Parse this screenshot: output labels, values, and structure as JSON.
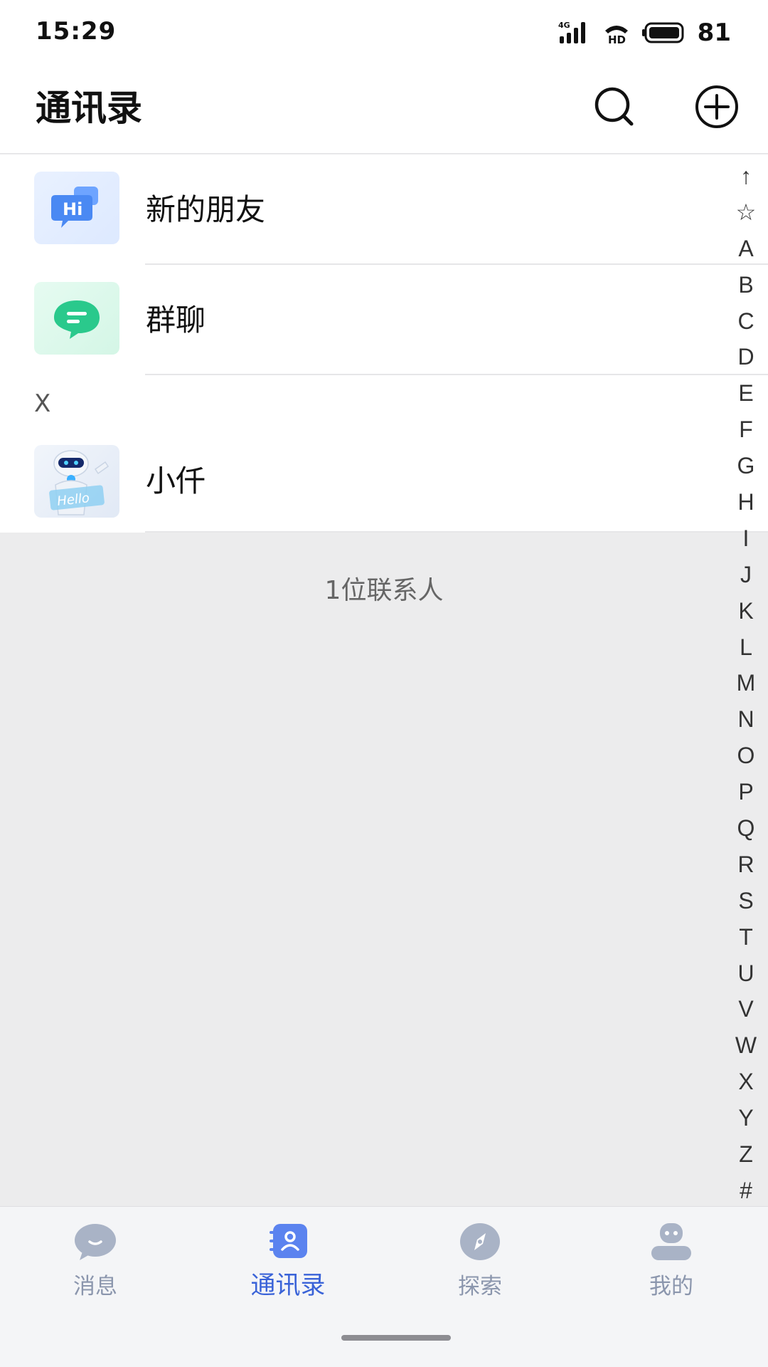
{
  "status_bar": {
    "time": "15:29",
    "network": "4G",
    "hd_label": "HD",
    "battery": "81"
  },
  "header": {
    "title": "通讯录",
    "icons": [
      "search-icon",
      "add-circle-icon"
    ]
  },
  "list": {
    "new_friends": "新的朋友",
    "group_chat": "群聊",
    "section_letter": "X",
    "contacts": [
      {
        "name": "小仟",
        "avatar_text": "Hello"
      }
    ],
    "new_friends_avatar_text": "Hi"
  },
  "contact_count": "1位联系人",
  "alpha_index": [
    "↑",
    "☆",
    "A",
    "B",
    "C",
    "D",
    "E",
    "F",
    "G",
    "H",
    "I",
    "J",
    "K",
    "L",
    "M",
    "N",
    "O",
    "P",
    "Q",
    "R",
    "S",
    "T",
    "U",
    "V",
    "W",
    "X",
    "Y",
    "Z",
    "#"
  ],
  "bottom_nav": {
    "items": [
      {
        "label": "消息",
        "icon": "message-bubble-icon",
        "active": false
      },
      {
        "label": "通讯录",
        "icon": "contacts-book-icon",
        "active": true
      },
      {
        "label": "探索",
        "icon": "compass-icon",
        "active": false
      },
      {
        "label": "我的",
        "icon": "profile-icon",
        "active": false
      }
    ]
  },
  "colors": {
    "accent": "#3a63d8",
    "nav_inactive": "#8b96ad",
    "group_green": "#27c98a",
    "background": "#ececed"
  }
}
